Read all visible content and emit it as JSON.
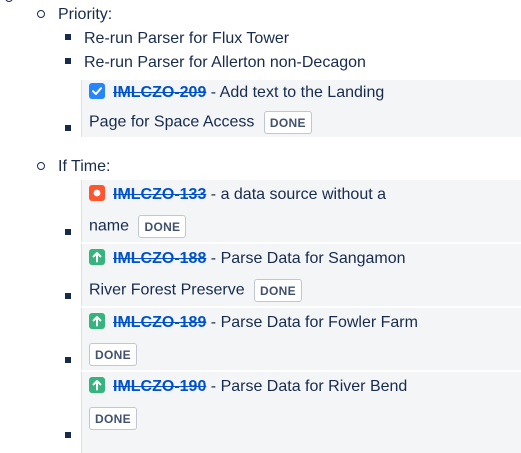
{
  "sections": [
    {
      "label": "Priority:",
      "items": [
        {
          "text": "Re-run Parser for Flux Tower"
        },
        {
          "text": "Re-run Parser for Allerton non-Decagon"
        }
      ],
      "issues": [
        {
          "icon": "task-checkbox-icon",
          "color": "#2684ff",
          "key": "IMLCZO-209",
          "summary_line1": " - Add text to the Landing",
          "summary_line2": "Page for Space Access",
          "status": "DONE"
        }
      ]
    },
    {
      "label": "If Time:",
      "issues": [
        {
          "icon": "bug-icon",
          "color": "#ff5630",
          "key": "IMLCZO-133",
          "summary_line1": " - a data source without a",
          "summary_line2": "name",
          "status": "DONE"
        },
        {
          "icon": "improvement-arrow-icon",
          "color": "#36b37e",
          "key": "IMLCZO-188",
          "summary_line1": " - Parse Data for Sangamon",
          "summary_line2": "River Forest Preserve",
          "status": "DONE"
        },
        {
          "icon": "improvement-arrow-icon",
          "color": "#36b37e",
          "key": "IMLCZO-189",
          "summary_line1": " - Parse Data for Fowler Farm",
          "status": "DONE"
        },
        {
          "icon": "improvement-arrow-icon",
          "color": "#36b37e",
          "key": "IMLCZO-190",
          "summary_line1": " - Parse Data for River Bend",
          "status": "DONE"
        }
      ]
    }
  ]
}
